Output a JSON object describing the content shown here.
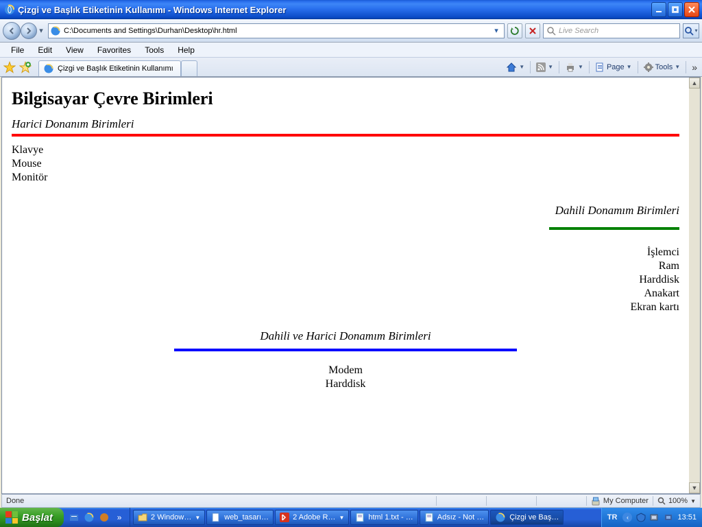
{
  "window": {
    "title": "Çizgi ve Başlık Etiketinin Kullanımı - Windows Internet Explorer",
    "address": "C:\\Documents and Settings\\Durhan\\Desktop\\hr.html",
    "search_placeholder": "Live Search",
    "tab_title": "Çizgi ve Başlık Etiketinin Kullanımı"
  },
  "menu": {
    "file": "File",
    "edit": "Edit",
    "view": "View",
    "favorites": "Favorites",
    "tools": "Tools",
    "help": "Help"
  },
  "cmd": {
    "page": "Page",
    "tools": "Tools"
  },
  "status": {
    "left": "Done",
    "zone": "My Computer",
    "zoom": "100%"
  },
  "page": {
    "heading": "Bilgisayar Çevre Birimleri",
    "sec1_title": "Harici Donanım Birimleri",
    "sec1_items": [
      "Klavye",
      "Mouse",
      "Monitör"
    ],
    "sec2_title": "Dahili Donamım Birimleri",
    "sec2_items": [
      "İşlemci",
      "Ram",
      "Harddisk",
      "Anakart",
      "Ekran kartı"
    ],
    "sec3_title": "Dahili ve Harici Donamım Birimleri",
    "sec3_items": [
      "Modem",
      "Harddisk"
    ]
  },
  "taskbar": {
    "start": "Başlat",
    "items": [
      "2 Window…",
      "web_tasarı…",
      "2 Adobe R…",
      "html 1.txt - …",
      "Adsız - Not …",
      "Çizgi ve Baş…"
    ],
    "lang": "TR",
    "clock": "13:51"
  }
}
